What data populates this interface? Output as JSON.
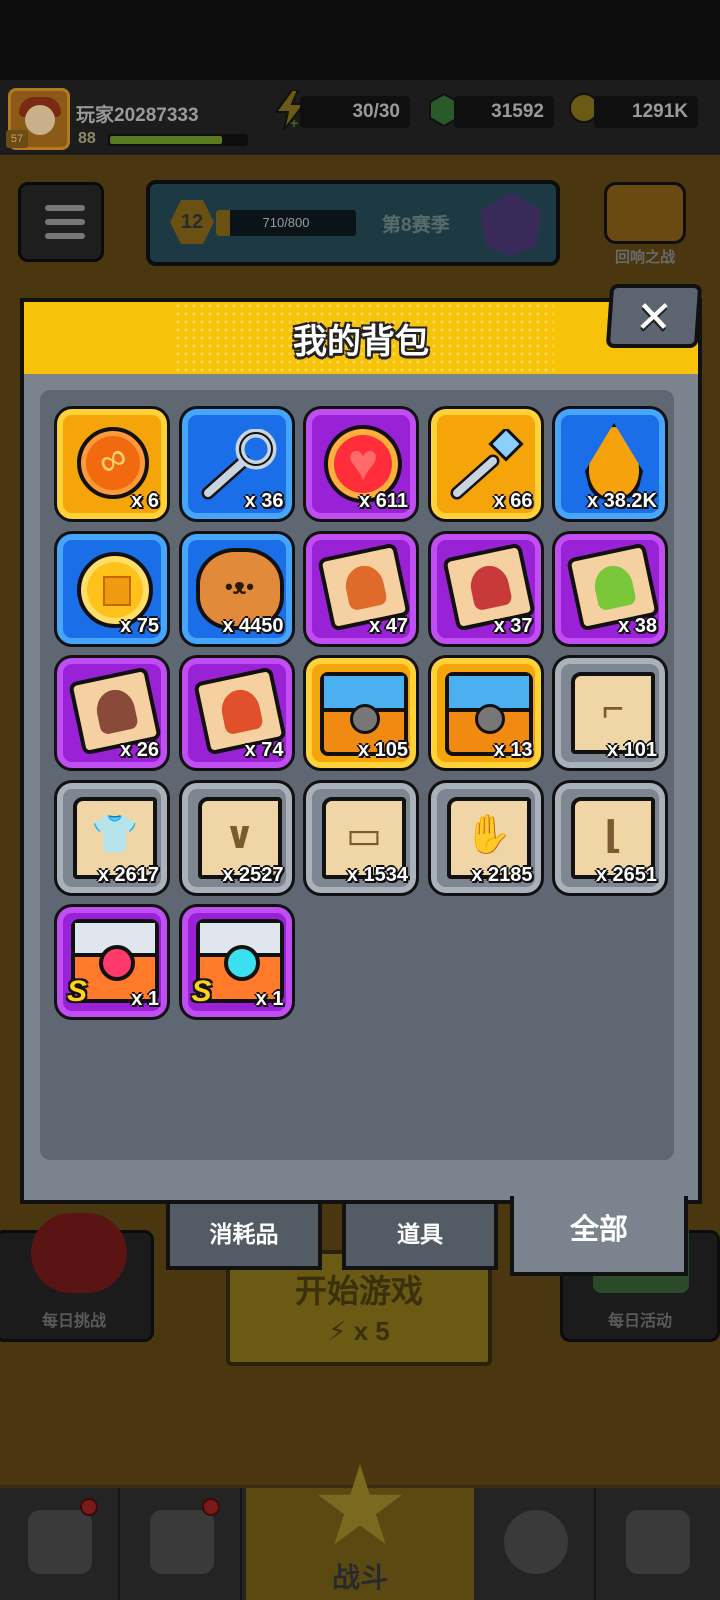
{
  "header": {
    "player_name": "玩家20287333",
    "player_level": "88",
    "avatar_level": "57",
    "energy": "30/30",
    "gems": "31592",
    "gold": "1291K"
  },
  "season": {
    "level": "12",
    "progress_text": "710/800",
    "label": "第8赛季"
  },
  "echo_battle": {
    "label": "回响之战"
  },
  "modal": {
    "title": "我的背包",
    "close_symbol": "✕",
    "tabs": [
      {
        "label": "消耗品",
        "active": false
      },
      {
        "label": "道具",
        "active": false
      },
      {
        "label": "全部",
        "active": true
      }
    ],
    "items": [
      {
        "icon": "orange-coin-icon",
        "frame": "orange",
        "count": "x 6"
      },
      {
        "icon": "silver-key-icon",
        "frame": "blue",
        "count": "x 36"
      },
      {
        "icon": "heart-orb-icon",
        "frame": "purple",
        "count": "x 611"
      },
      {
        "icon": "gem-key-icon",
        "frame": "orange",
        "count": "x 66"
      },
      {
        "icon": "oil-drop-icon",
        "frame": "blue",
        "count": "x 38.2K"
      },
      {
        "icon": "gold-cube-coin-icon",
        "frame": "blue",
        "count": "x 75"
      },
      {
        "icon": "dog-face-icon",
        "frame": "blue",
        "count": "x 4450"
      },
      {
        "icon": "hero-puzzle-icon",
        "frame": "purple",
        "count": "x 47",
        "accent": "#e06a2a"
      },
      {
        "icon": "hero-puzzle-icon",
        "frame": "purple",
        "count": "x 37",
        "accent": "#c83a3a"
      },
      {
        "icon": "hero-puzzle-icon",
        "frame": "purple",
        "count": "x 38",
        "accent": "#7ac83a"
      },
      {
        "icon": "hero-puzzle-icon",
        "frame": "purple",
        "count": "x 26",
        "accent": "#8a4a3a"
      },
      {
        "icon": "hero-puzzle-icon",
        "frame": "purple",
        "count": "x 74",
        "accent": "#e0502a"
      },
      {
        "icon": "treasure-chest-icon",
        "frame": "orange",
        "count": "x 105"
      },
      {
        "icon": "treasure-chest-icon",
        "frame": "orange",
        "count": "x 13"
      },
      {
        "icon": "weapon-scroll-icon",
        "frame": "gray",
        "count": "x 101",
        "symbol": "⌐"
      },
      {
        "icon": "armor-scroll-icon",
        "frame": "gray",
        "count": "x 2617",
        "symbol": "👕"
      },
      {
        "icon": "necklace-scroll-icon",
        "frame": "gray",
        "count": "x 2527",
        "symbol": "∨"
      },
      {
        "icon": "belt-scroll-icon",
        "frame": "gray",
        "count": "x 1534",
        "symbol": "▭"
      },
      {
        "icon": "glove-scroll-icon",
        "frame": "gray",
        "count": "x 2185",
        "symbol": "✋"
      },
      {
        "icon": "boot-scroll-icon",
        "frame": "gray",
        "count": "x 2651",
        "symbol": "⌊"
      },
      {
        "icon": "s-heart-chest-icon",
        "frame": "purple",
        "count": "x 1",
        "grade": "S",
        "gem_color": "#ff3a6a"
      },
      {
        "icon": "s-gem-chest-icon",
        "frame": "purple",
        "count": "x 1",
        "grade": "S",
        "gem_color": "#3ae0f0"
      }
    ]
  },
  "background": {
    "daily_challenge": "每日挑战",
    "start_game": "开始游戏",
    "start_cost": "x 5",
    "daily_event": "每日活动",
    "battle_tab": "战斗"
  },
  "colors": {
    "header_yellow": "#f7c20a",
    "panel_gray": "#7b848e",
    "frame_orange": "#f5a50a",
    "frame_blue": "#1a6ee8",
    "frame_purple": "#9a22d6",
    "frame_gray": "#7e8791"
  }
}
